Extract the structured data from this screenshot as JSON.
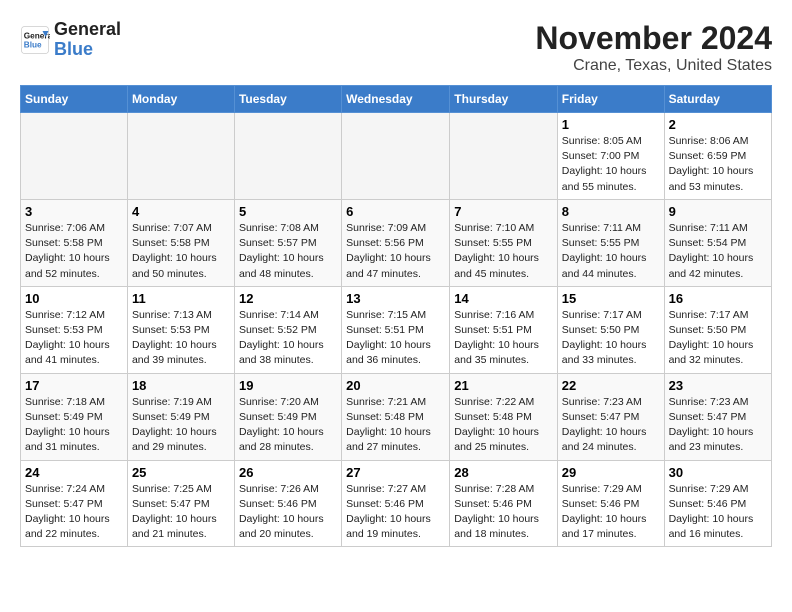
{
  "header": {
    "logo_general": "General",
    "logo_blue": "Blue",
    "month_title": "November 2024",
    "location": "Crane, Texas, United States"
  },
  "weekdays": [
    "Sunday",
    "Monday",
    "Tuesday",
    "Wednesday",
    "Thursday",
    "Friday",
    "Saturday"
  ],
  "weeks": [
    [
      {
        "day": "",
        "info": ""
      },
      {
        "day": "",
        "info": ""
      },
      {
        "day": "",
        "info": ""
      },
      {
        "day": "",
        "info": ""
      },
      {
        "day": "",
        "info": ""
      },
      {
        "day": "1",
        "info": "Sunrise: 8:05 AM\nSunset: 7:00 PM\nDaylight: 10 hours\nand 55 minutes."
      },
      {
        "day": "2",
        "info": "Sunrise: 8:06 AM\nSunset: 6:59 PM\nDaylight: 10 hours\nand 53 minutes."
      }
    ],
    [
      {
        "day": "3",
        "info": "Sunrise: 7:06 AM\nSunset: 5:58 PM\nDaylight: 10 hours\nand 52 minutes."
      },
      {
        "day": "4",
        "info": "Sunrise: 7:07 AM\nSunset: 5:58 PM\nDaylight: 10 hours\nand 50 minutes."
      },
      {
        "day": "5",
        "info": "Sunrise: 7:08 AM\nSunset: 5:57 PM\nDaylight: 10 hours\nand 48 minutes."
      },
      {
        "day": "6",
        "info": "Sunrise: 7:09 AM\nSunset: 5:56 PM\nDaylight: 10 hours\nand 47 minutes."
      },
      {
        "day": "7",
        "info": "Sunrise: 7:10 AM\nSunset: 5:55 PM\nDaylight: 10 hours\nand 45 minutes."
      },
      {
        "day": "8",
        "info": "Sunrise: 7:11 AM\nSunset: 5:55 PM\nDaylight: 10 hours\nand 44 minutes."
      },
      {
        "day": "9",
        "info": "Sunrise: 7:11 AM\nSunset: 5:54 PM\nDaylight: 10 hours\nand 42 minutes."
      }
    ],
    [
      {
        "day": "10",
        "info": "Sunrise: 7:12 AM\nSunset: 5:53 PM\nDaylight: 10 hours\nand 41 minutes."
      },
      {
        "day": "11",
        "info": "Sunrise: 7:13 AM\nSunset: 5:53 PM\nDaylight: 10 hours\nand 39 minutes."
      },
      {
        "day": "12",
        "info": "Sunrise: 7:14 AM\nSunset: 5:52 PM\nDaylight: 10 hours\nand 38 minutes."
      },
      {
        "day": "13",
        "info": "Sunrise: 7:15 AM\nSunset: 5:51 PM\nDaylight: 10 hours\nand 36 minutes."
      },
      {
        "day": "14",
        "info": "Sunrise: 7:16 AM\nSunset: 5:51 PM\nDaylight: 10 hours\nand 35 minutes."
      },
      {
        "day": "15",
        "info": "Sunrise: 7:17 AM\nSunset: 5:50 PM\nDaylight: 10 hours\nand 33 minutes."
      },
      {
        "day": "16",
        "info": "Sunrise: 7:17 AM\nSunset: 5:50 PM\nDaylight: 10 hours\nand 32 minutes."
      }
    ],
    [
      {
        "day": "17",
        "info": "Sunrise: 7:18 AM\nSunset: 5:49 PM\nDaylight: 10 hours\nand 31 minutes."
      },
      {
        "day": "18",
        "info": "Sunrise: 7:19 AM\nSunset: 5:49 PM\nDaylight: 10 hours\nand 29 minutes."
      },
      {
        "day": "19",
        "info": "Sunrise: 7:20 AM\nSunset: 5:49 PM\nDaylight: 10 hours\nand 28 minutes."
      },
      {
        "day": "20",
        "info": "Sunrise: 7:21 AM\nSunset: 5:48 PM\nDaylight: 10 hours\nand 27 minutes."
      },
      {
        "day": "21",
        "info": "Sunrise: 7:22 AM\nSunset: 5:48 PM\nDaylight: 10 hours\nand 25 minutes."
      },
      {
        "day": "22",
        "info": "Sunrise: 7:23 AM\nSunset: 5:47 PM\nDaylight: 10 hours\nand 24 minutes."
      },
      {
        "day": "23",
        "info": "Sunrise: 7:23 AM\nSunset: 5:47 PM\nDaylight: 10 hours\nand 23 minutes."
      }
    ],
    [
      {
        "day": "24",
        "info": "Sunrise: 7:24 AM\nSunset: 5:47 PM\nDaylight: 10 hours\nand 22 minutes."
      },
      {
        "day": "25",
        "info": "Sunrise: 7:25 AM\nSunset: 5:47 PM\nDaylight: 10 hours\nand 21 minutes."
      },
      {
        "day": "26",
        "info": "Sunrise: 7:26 AM\nSunset: 5:46 PM\nDaylight: 10 hours\nand 20 minutes."
      },
      {
        "day": "27",
        "info": "Sunrise: 7:27 AM\nSunset: 5:46 PM\nDaylight: 10 hours\nand 19 minutes."
      },
      {
        "day": "28",
        "info": "Sunrise: 7:28 AM\nSunset: 5:46 PM\nDaylight: 10 hours\nand 18 minutes."
      },
      {
        "day": "29",
        "info": "Sunrise: 7:29 AM\nSunset: 5:46 PM\nDaylight: 10 hours\nand 17 minutes."
      },
      {
        "day": "30",
        "info": "Sunrise: 7:29 AM\nSunset: 5:46 PM\nDaylight: 10 hours\nand 16 minutes."
      }
    ]
  ]
}
